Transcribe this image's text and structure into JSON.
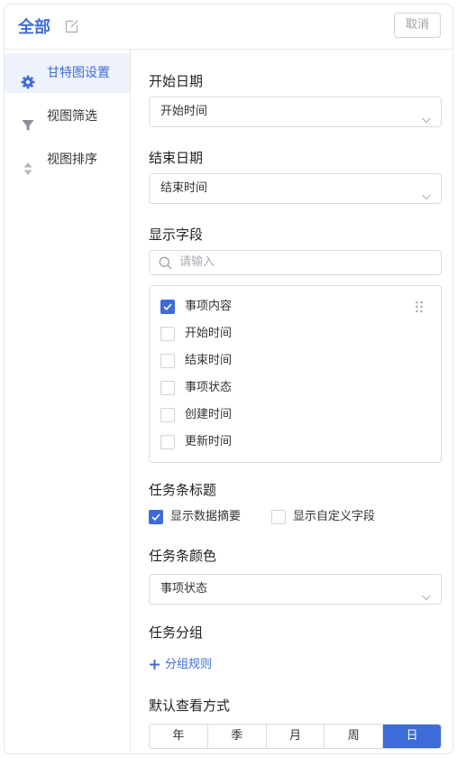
{
  "header": {
    "title": "全部",
    "cancel_label": "取消"
  },
  "sidebar": {
    "items": [
      {
        "label": "甘特图设置",
        "icon": "gear-icon",
        "active": true
      },
      {
        "label": "视图筛选",
        "icon": "filter-icon",
        "active": false
      },
      {
        "label": "视图排序",
        "icon": "sort-icon",
        "active": false
      }
    ]
  },
  "main": {
    "start_date": {
      "label": "开始日期",
      "value": "开始时间"
    },
    "end_date": {
      "label": "结束日期",
      "value": "结束时间"
    },
    "display_fields": {
      "label": "显示字段",
      "search_placeholder": "请输入",
      "fields": [
        {
          "label": "事项内容",
          "checked": true
        },
        {
          "label": "开始时间",
          "checked": false
        },
        {
          "label": "结束时间",
          "checked": false
        },
        {
          "label": "事项状态",
          "checked": false
        },
        {
          "label": "创建时间",
          "checked": false
        },
        {
          "label": "更新时间",
          "checked": false
        }
      ]
    },
    "bar_title": {
      "label": "任务条标题",
      "options": [
        {
          "label": "显示数据摘要",
          "checked": true
        },
        {
          "label": "显示自定义字段",
          "checked": false
        }
      ]
    },
    "bar_color": {
      "label": "任务条颜色",
      "value": "事项状态"
    },
    "grouping": {
      "label": "任务分组",
      "add_label": "分组规则"
    },
    "default_view": {
      "label": "默认查看方式",
      "options": [
        "年",
        "季",
        "月",
        "周",
        "日"
      ],
      "selected": "日"
    }
  },
  "colors": {
    "accent": "#3d6cd8",
    "border": "#d8dbe0",
    "active_bg": "#eef2fc"
  }
}
